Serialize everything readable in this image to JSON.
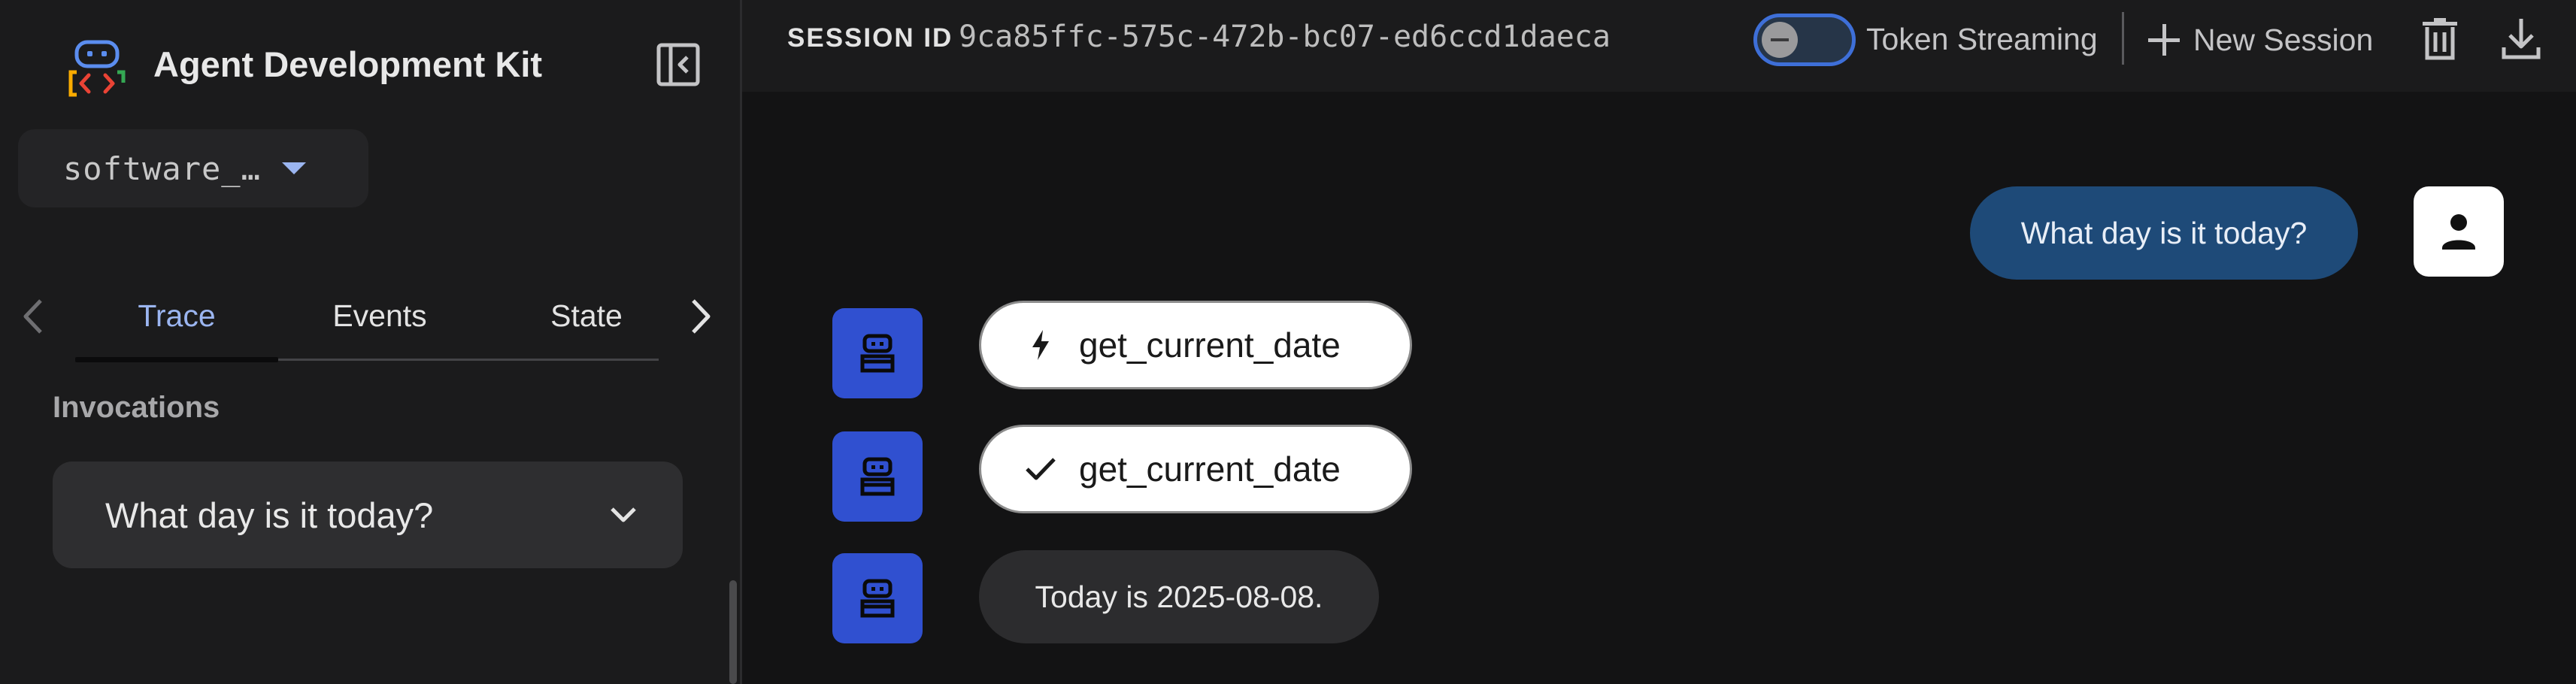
{
  "sidebar": {
    "brand_title": "Agent Development Kit",
    "app_select": {
      "value": "software_…"
    },
    "tabs": [
      {
        "label": "Trace",
        "active": true
      },
      {
        "label": "Events",
        "active": false
      },
      {
        "label": "State",
        "active": false
      }
    ],
    "invocations_label": "Invocations",
    "invocations": [
      {
        "label": "What day is it today?"
      }
    ]
  },
  "topbar": {
    "session_label": "SESSION ID",
    "session_id": "9ca85ffc-575c-472b-bc07-ed6ccd1daeca",
    "token_streaming_label": "Token Streaming",
    "token_streaming_enabled": false,
    "new_session_label": "New Session"
  },
  "chat": {
    "messages": [
      {
        "role": "user",
        "text": "What day is it today?"
      },
      {
        "role": "bot",
        "kind": "function_call",
        "icon": "bolt-icon",
        "text": "get_current_date"
      },
      {
        "role": "bot",
        "kind": "function_response",
        "icon": "check-icon",
        "text": "get_current_date"
      },
      {
        "role": "bot",
        "kind": "text",
        "text": "Today is 2025-08-08."
      }
    ]
  },
  "colors": {
    "accent": "#9bb5f0",
    "user_bubble": "#1e4a78",
    "bot_avatar": "#3050d0",
    "background": "#131314",
    "sidebar": "#1b1b1c"
  }
}
